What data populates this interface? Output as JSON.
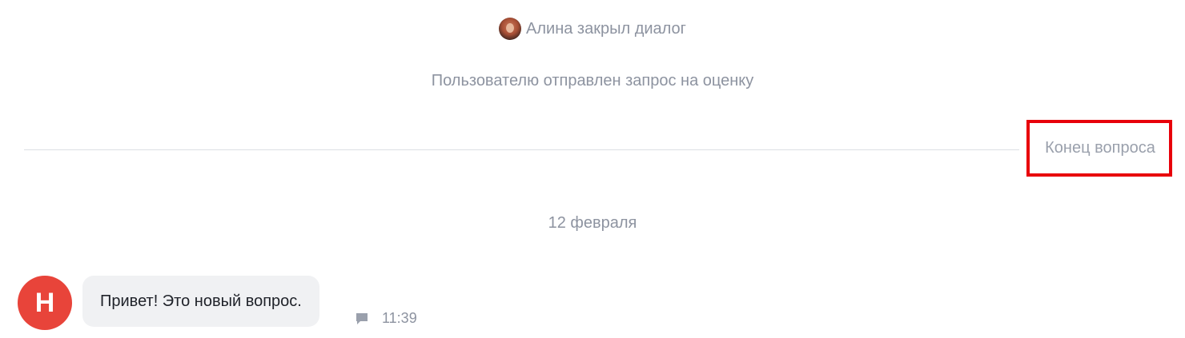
{
  "events": {
    "closed_text": "Алина закрыл диалог",
    "rating_request": "Пользователю отправлен запрос на оценку"
  },
  "divider": {
    "end_label": "Конец вопроса",
    "highlight_color": "#e8000b"
  },
  "date_separator": "12 февраля",
  "message": {
    "avatar_letter": "Н",
    "avatar_color": "#e8443a",
    "text": "Привет! Это новый вопрос.",
    "time": "11:39",
    "channel_icon": "comment-icon"
  }
}
